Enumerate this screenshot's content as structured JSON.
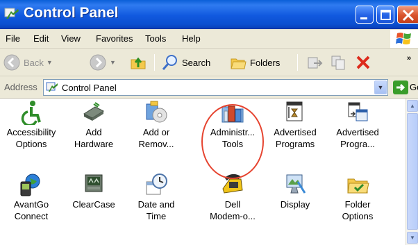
{
  "window": {
    "title": "Control Panel"
  },
  "menu": [
    "File",
    "Edit",
    "View",
    "Favorites",
    "Tools",
    "Help"
  ],
  "toolbar": {
    "back": "Back",
    "search": "Search",
    "folders": "Folders",
    "overflow": "»"
  },
  "address": {
    "label": "Address",
    "value": "Control Panel",
    "go": "Go"
  },
  "items": [
    {
      "label1": "Accessibility",
      "label2": "Options",
      "icon": "accessibility-icon"
    },
    {
      "label1": "Add",
      "label2": "Hardware",
      "icon": "add-hardware-icon"
    },
    {
      "label1": "Add or",
      "label2": "Remov...",
      "icon": "add-remove-programs-icon"
    },
    {
      "label1": "Administr...",
      "label2": "Tools",
      "icon": "administrative-tools-icon"
    },
    {
      "label1": "Advertised",
      "label2": "Programs",
      "icon": "advertised-programs-icon"
    },
    {
      "label1": "Advertised",
      "label2": "Progra...",
      "icon": "advertised-programs-icon"
    },
    {
      "label1": "AvantGo",
      "label2": "Connect",
      "icon": "avantgo-connect-icon"
    },
    {
      "label1": "ClearCase",
      "label2": "",
      "icon": "clearcase-icon"
    },
    {
      "label1": "Date and",
      "label2": "Time",
      "icon": "date-time-icon"
    },
    {
      "label1": "Dell",
      "label2": "Modem-o...",
      "icon": "dell-modem-icon"
    },
    {
      "label1": "Display",
      "label2": "",
      "icon": "display-icon"
    },
    {
      "label1": "Folder",
      "label2": "Options",
      "icon": "folder-options-icon"
    }
  ],
  "colors": {
    "titlebar": "#0b4fd0",
    "highlight": "#e64430",
    "accent": "#3a9d2a"
  }
}
